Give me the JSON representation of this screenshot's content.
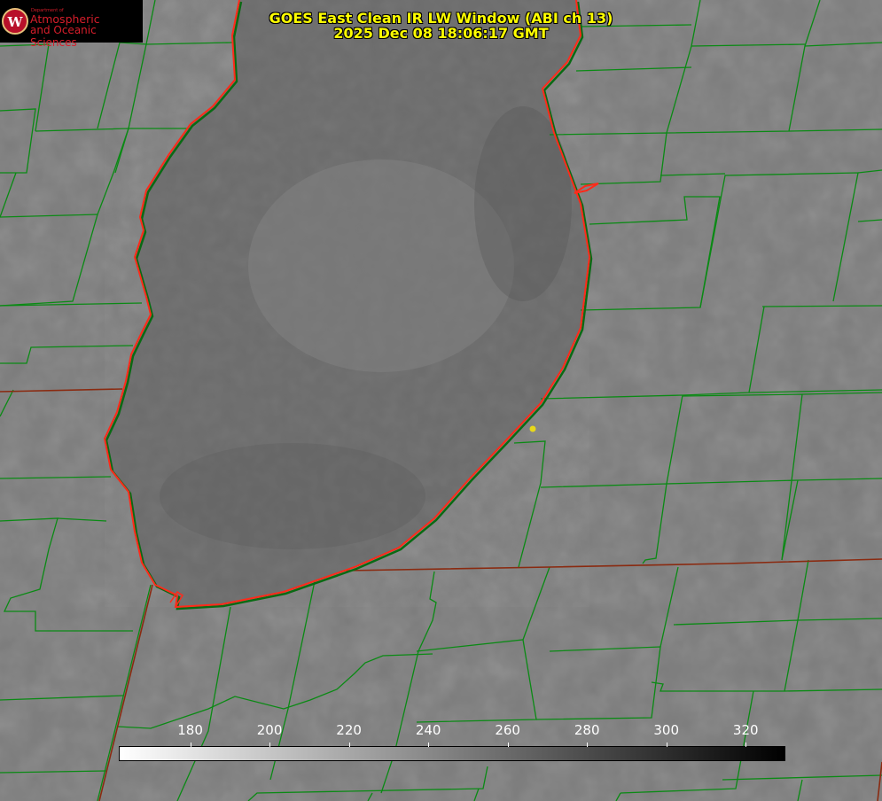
{
  "title": {
    "line1": "GOES East Clean IR LW Window (ABI ch 13)",
    "line2": "2025 Dec 08 18:06:17 GMT"
  },
  "logo": {
    "department": "Department of",
    "line1": "Atmospheric",
    "line2": "and Oceanic Sciences"
  },
  "colorbar": {
    "min": 162,
    "max": 330,
    "ticks": [
      "180",
      "200",
      "220",
      "240",
      "260",
      "280",
      "300",
      "320"
    ],
    "low_color": "#ffffff",
    "high_color": "#000000"
  },
  "colors": {
    "lake_shoreline": "#ff2a1a",
    "county_lines": "#0a8a14",
    "state_lines": "#8a2a10",
    "marker": "#e8d81a",
    "title_text": "#ffff00"
  }
}
